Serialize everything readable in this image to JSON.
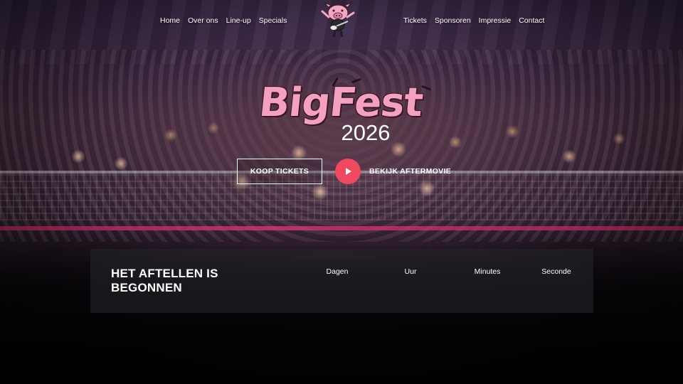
{
  "nav": {
    "left": [
      "Home",
      "Over ons",
      "Line-up",
      "Specials"
    ],
    "right": [
      "Tickets",
      "Sponsoren",
      "Impressie",
      "Contact"
    ]
  },
  "logo": {
    "icon": "pig-with-guitar-logo"
  },
  "hero": {
    "brand_name": "BigFest",
    "year": "2026",
    "tickets_button": "KOOP TICKETS",
    "aftermovie_label": "BEKIJK AFTERMOVIE",
    "play_icon": "play-icon"
  },
  "countdown": {
    "title": "HET AFTELLEN IS BEGONNEN",
    "units": [
      "Dagen",
      "Uur",
      "Minutes",
      "Seconde"
    ]
  },
  "colors": {
    "accent": "#f0495f",
    "brand_pink": "#f4a0bf",
    "stage_pink": "#e0357a"
  }
}
